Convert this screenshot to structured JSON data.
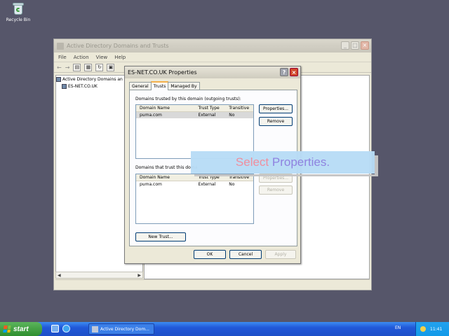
{
  "desktop": {
    "recycle_bin_label": "Recycle Bin"
  },
  "mmc": {
    "title": "Active Directory Domains and Trusts",
    "menu": [
      "File",
      "Action",
      "View",
      "Help"
    ],
    "tree": {
      "root": "Active Directory Domains an",
      "child": "ES-NET.CO.UK"
    }
  },
  "dialog": {
    "title": "ES-NET.CO.UK Properties",
    "tabs": [
      "General",
      "Trusts",
      "Managed By"
    ],
    "active_tab": "Trusts",
    "outgoing_label": "Domains trusted by this domain (outgoing trusts):",
    "incoming_label": "Domains that trust this doma",
    "columns": [
      "Domain Name",
      "Trust Type",
      "Transitive"
    ],
    "outgoing_rows": [
      {
        "name": "puma.com",
        "type": "External",
        "transitive": "No"
      }
    ],
    "incoming_rows": [
      {
        "name": "puma.com",
        "type": "External",
        "transitive": "No"
      }
    ],
    "buttons": {
      "properties": "Properties...",
      "remove": "Remove",
      "properties2": "Properties...",
      "remove2": "Remove",
      "new_trust": "New Trust...",
      "ok": "OK",
      "cancel": "Cancel",
      "apply": "Apply"
    }
  },
  "callout": {
    "word1": "Select",
    "word2": "Properties."
  },
  "taskbar": {
    "start_label": "start",
    "task_label": "Active Directory Dom...",
    "lang": "EN",
    "clock": "11:41"
  }
}
